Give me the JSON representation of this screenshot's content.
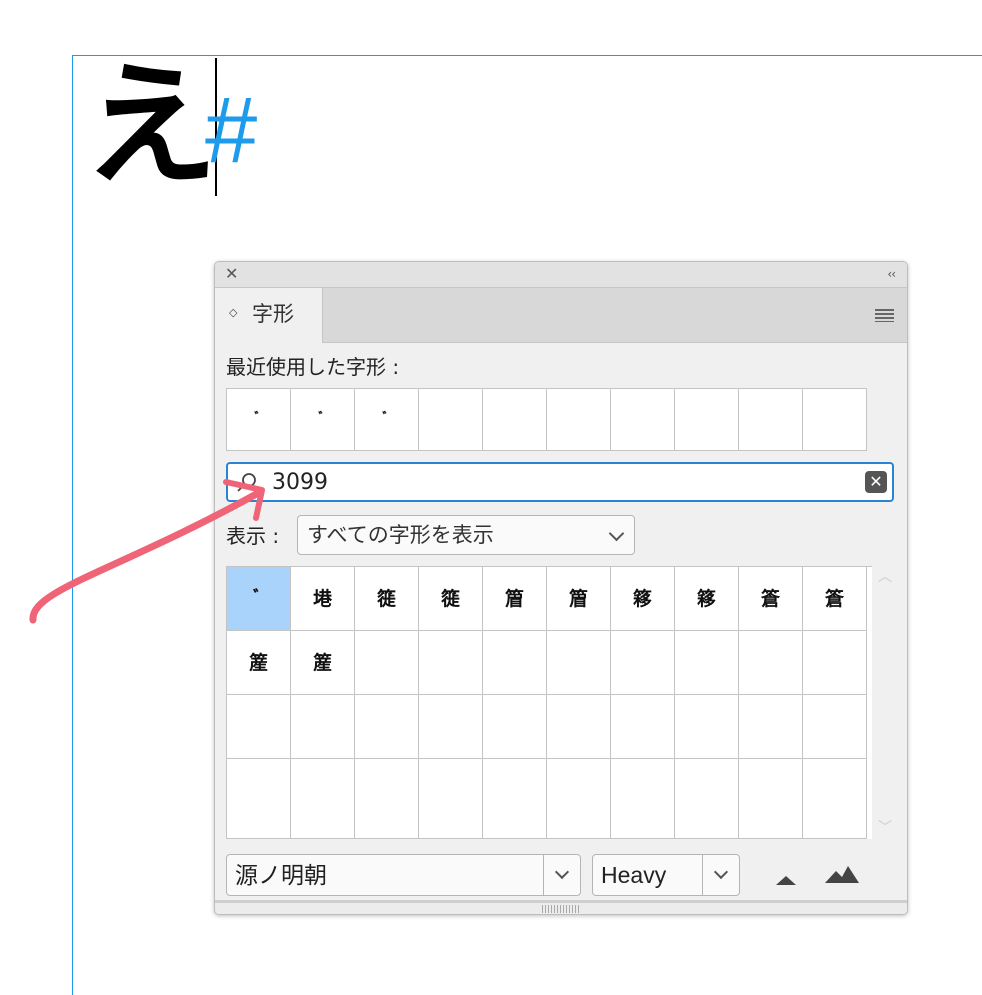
{
  "document": {
    "character": "え",
    "hidden_char_mark": "#"
  },
  "panel": {
    "close_icon": "✕",
    "collapse_icon": "‹‹",
    "tab": {
      "updown": "◇",
      "label": "字形"
    },
    "recent": {
      "label": "最近使用した字形 :",
      "items": [
        "゙",
        "゙",
        "゙",
        "",
        "",
        "",
        "",
        "",
        "",
        ""
      ]
    },
    "search": {
      "value": "3099",
      "clear_icon": "✕"
    },
    "show": {
      "label": "表示 :",
      "selected": "すべての字形を表示"
    },
    "glyphs": [
      "゙",
      "塂",
      "簁",
      "簁",
      "篃",
      "篃",
      "簃",
      "簃",
      "篬",
      "篬",
      "簅",
      "簅",
      "",
      "",
      "",
      "",
      "",
      "",
      "",
      "",
      "",
      "",
      "",
      "",
      "",
      "",
      "",
      "",
      "",
      "",
      "",
      "",
      "",
      "",
      "",
      "",
      "",
      "",
      "",
      ""
    ],
    "selected_index": 0,
    "font_family": "源ノ明朝",
    "font_style": "Heavy"
  },
  "colors": {
    "accent": "#2a84d6",
    "guide": "#1e9bea",
    "selection": "#a9d3fb",
    "annotation_arrow": "#f06478"
  }
}
